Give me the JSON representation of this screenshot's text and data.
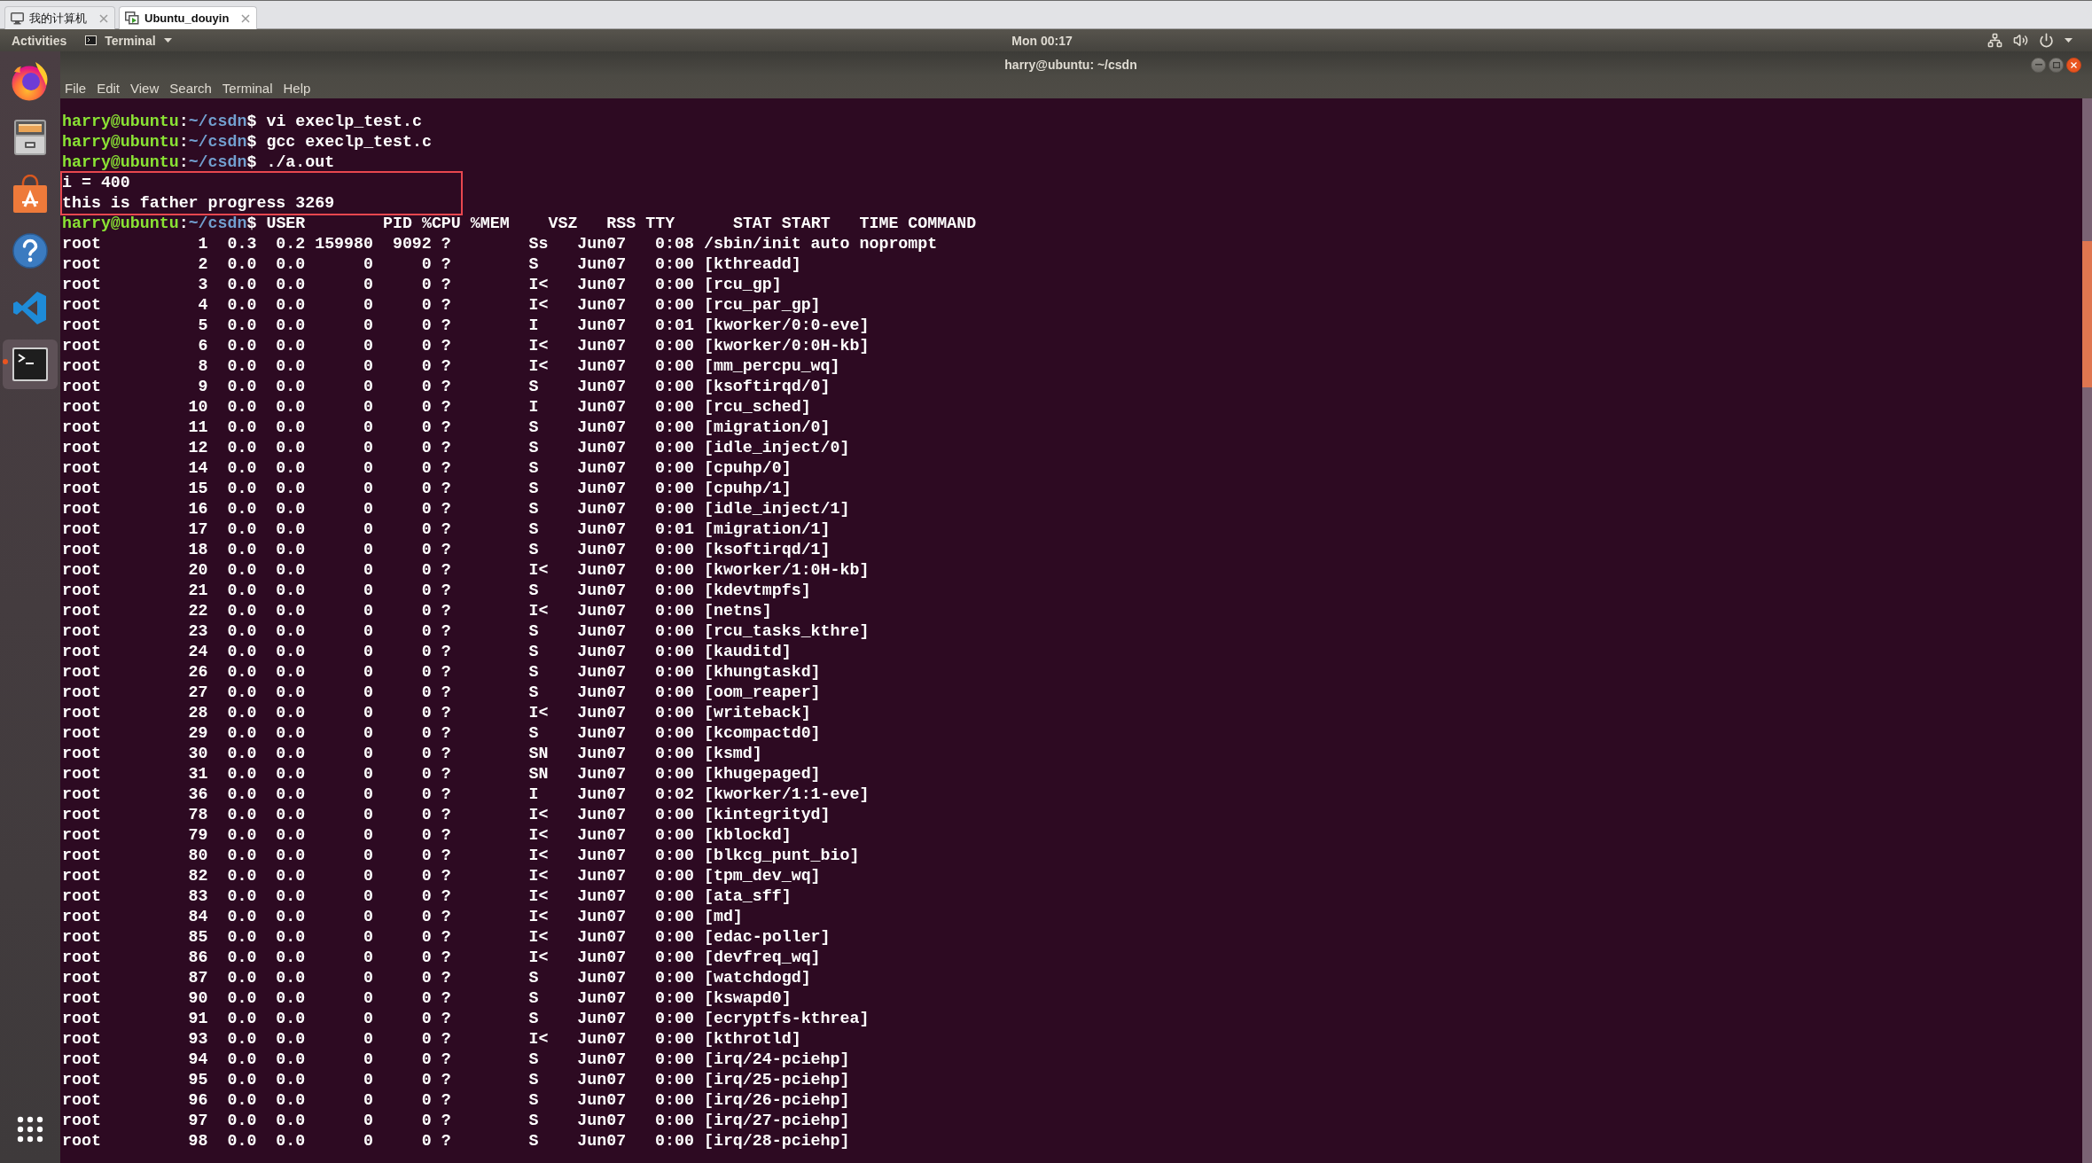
{
  "host_tabs": [
    {
      "kind": "computer",
      "label": "我的计算机",
      "selected": false
    },
    {
      "kind": "machine",
      "label": "Ubuntu_douyin",
      "selected": true
    }
  ],
  "top_bar": {
    "activities": "Activities",
    "app_menu": "Terminal",
    "clock": "Mon 00:17"
  },
  "dock": {
    "items": [
      {
        "kind": "browser",
        "running": false,
        "selected": false
      },
      {
        "kind": "files",
        "running": false,
        "selected": false
      },
      {
        "kind": "store",
        "running": false,
        "selected": false
      },
      {
        "kind": "help",
        "running": false,
        "selected": false
      },
      {
        "kind": "editor",
        "running": false,
        "selected": false
      },
      {
        "kind": "terminal",
        "running": true,
        "selected": true
      }
    ]
  },
  "window": {
    "title": "harry@ubuntu: ~/csdn",
    "menu": [
      "File",
      "Edit",
      "View",
      "Search",
      "Terminal",
      "Help"
    ]
  },
  "terminal": {
    "commands": [
      {
        "prompt": {
          "user": "harry@ubuntu",
          "separator": ":",
          "path": "~/csdn",
          "symbol": "$"
        },
        "command": "vi execlp_test.c"
      },
      {
        "prompt": {
          "user": "harry@ubuntu",
          "separator": ":",
          "path": "~/csdn",
          "symbol": "$"
        },
        "command": "gcc execlp_test.c"
      },
      {
        "prompt": {
          "user": "harry@ubuntu",
          "separator": ":",
          "path": "~/csdn",
          "symbol": "$"
        },
        "command": "./a.out"
      }
    ],
    "highlighted_output": [
      "i = 400",
      "this is father progress 3269"
    ],
    "ps_header_line": {
      "prompt": {
        "user": "harry@ubuntu",
        "separator": ":",
        "path": "~/csdn",
        "symbol": "$"
      },
      "fields": [
        "USER",
        "PID",
        "%CPU",
        "%MEM",
        "VSZ",
        "RSS",
        "TTY",
        "STAT",
        "START",
        "TIME",
        "COMMAND"
      ]
    },
    "ps_output": {
      "rows": [
        [
          "root",
          "1",
          "0.3",
          "0.2",
          "159980",
          "9092",
          "?",
          "Ss",
          "Jun07",
          "0:08",
          "/sbin/init auto noprompt"
        ],
        [
          "root",
          "2",
          "0.0",
          "0.0",
          "0",
          "0",
          "?",
          "S",
          "Jun07",
          "0:00",
          "[kthreadd]"
        ],
        [
          "root",
          "3",
          "0.0",
          "0.0",
          "0",
          "0",
          "?",
          "I<",
          "Jun07",
          "0:00",
          "[rcu_gp]"
        ],
        [
          "root",
          "4",
          "0.0",
          "0.0",
          "0",
          "0",
          "?",
          "I<",
          "Jun07",
          "0:00",
          "[rcu_par_gp]"
        ],
        [
          "root",
          "5",
          "0.0",
          "0.0",
          "0",
          "0",
          "?",
          "I",
          "Jun07",
          "0:01",
          "[kworker/0:0-eve]"
        ],
        [
          "root",
          "6",
          "0.0",
          "0.0",
          "0",
          "0",
          "?",
          "I<",
          "Jun07",
          "0:00",
          "[kworker/0:0H-kb]"
        ],
        [
          "root",
          "8",
          "0.0",
          "0.0",
          "0",
          "0",
          "?",
          "I<",
          "Jun07",
          "0:00",
          "[mm_percpu_wq]"
        ],
        [
          "root",
          "9",
          "0.0",
          "0.0",
          "0",
          "0",
          "?",
          "S",
          "Jun07",
          "0:00",
          "[ksoftirqd/0]"
        ],
        [
          "root",
          "10",
          "0.0",
          "0.0",
          "0",
          "0",
          "?",
          "I",
          "Jun07",
          "0:00",
          "[rcu_sched]"
        ],
        [
          "root",
          "11",
          "0.0",
          "0.0",
          "0",
          "0",
          "?",
          "S",
          "Jun07",
          "0:00",
          "[migration/0]"
        ],
        [
          "root",
          "12",
          "0.0",
          "0.0",
          "0",
          "0",
          "?",
          "S",
          "Jun07",
          "0:00",
          "[idle_inject/0]"
        ],
        [
          "root",
          "14",
          "0.0",
          "0.0",
          "0",
          "0",
          "?",
          "S",
          "Jun07",
          "0:00",
          "[cpuhp/0]"
        ],
        [
          "root",
          "15",
          "0.0",
          "0.0",
          "0",
          "0",
          "?",
          "S",
          "Jun07",
          "0:00",
          "[cpuhp/1]"
        ],
        [
          "root",
          "16",
          "0.0",
          "0.0",
          "0",
          "0",
          "?",
          "S",
          "Jun07",
          "0:00",
          "[idle_inject/1]"
        ],
        [
          "root",
          "17",
          "0.0",
          "0.0",
          "0",
          "0",
          "?",
          "S",
          "Jun07",
          "0:01",
          "[migration/1]"
        ],
        [
          "root",
          "18",
          "0.0",
          "0.0",
          "0",
          "0",
          "?",
          "S",
          "Jun07",
          "0:00",
          "[ksoftirqd/1]"
        ],
        [
          "root",
          "20",
          "0.0",
          "0.0",
          "0",
          "0",
          "?",
          "I<",
          "Jun07",
          "0:00",
          "[kworker/1:0H-kb]"
        ],
        [
          "root",
          "21",
          "0.0",
          "0.0",
          "0",
          "0",
          "?",
          "S",
          "Jun07",
          "0:00",
          "[kdevtmpfs]"
        ],
        [
          "root",
          "22",
          "0.0",
          "0.0",
          "0",
          "0",
          "?",
          "I<",
          "Jun07",
          "0:00",
          "[netns]"
        ],
        [
          "root",
          "23",
          "0.0",
          "0.0",
          "0",
          "0",
          "?",
          "S",
          "Jun07",
          "0:00",
          "[rcu_tasks_kthre]"
        ],
        [
          "root",
          "24",
          "0.0",
          "0.0",
          "0",
          "0",
          "?",
          "S",
          "Jun07",
          "0:00",
          "[kauditd]"
        ],
        [
          "root",
          "26",
          "0.0",
          "0.0",
          "0",
          "0",
          "?",
          "S",
          "Jun07",
          "0:00",
          "[khungtaskd]"
        ],
        [
          "root",
          "27",
          "0.0",
          "0.0",
          "0",
          "0",
          "?",
          "S",
          "Jun07",
          "0:00",
          "[oom_reaper]"
        ],
        [
          "root",
          "28",
          "0.0",
          "0.0",
          "0",
          "0",
          "?",
          "I<",
          "Jun07",
          "0:00",
          "[writeback]"
        ],
        [
          "root",
          "29",
          "0.0",
          "0.0",
          "0",
          "0",
          "?",
          "S",
          "Jun07",
          "0:00",
          "[kcompactd0]"
        ],
        [
          "root",
          "30",
          "0.0",
          "0.0",
          "0",
          "0",
          "?",
          "SN",
          "Jun07",
          "0:00",
          "[ksmd]"
        ],
        [
          "root",
          "31",
          "0.0",
          "0.0",
          "0",
          "0",
          "?",
          "SN",
          "Jun07",
          "0:00",
          "[khugepaged]"
        ],
        [
          "root",
          "36",
          "0.0",
          "0.0",
          "0",
          "0",
          "?",
          "I",
          "Jun07",
          "0:02",
          "[kworker/1:1-eve]"
        ],
        [
          "root",
          "78",
          "0.0",
          "0.0",
          "0",
          "0",
          "?",
          "I<",
          "Jun07",
          "0:00",
          "[kintegrityd]"
        ],
        [
          "root",
          "79",
          "0.0",
          "0.0",
          "0",
          "0",
          "?",
          "I<",
          "Jun07",
          "0:00",
          "[kblockd]"
        ],
        [
          "root",
          "80",
          "0.0",
          "0.0",
          "0",
          "0",
          "?",
          "I<",
          "Jun07",
          "0:00",
          "[blkcg_punt_bio]"
        ],
        [
          "root",
          "82",
          "0.0",
          "0.0",
          "0",
          "0",
          "?",
          "I<",
          "Jun07",
          "0:00",
          "[tpm_dev_wq]"
        ],
        [
          "root",
          "83",
          "0.0",
          "0.0",
          "0",
          "0",
          "?",
          "I<",
          "Jun07",
          "0:00",
          "[ata_sff]"
        ],
        [
          "root",
          "84",
          "0.0",
          "0.0",
          "0",
          "0",
          "?",
          "I<",
          "Jun07",
          "0:00",
          "[md]"
        ],
        [
          "root",
          "85",
          "0.0",
          "0.0",
          "0",
          "0",
          "?",
          "I<",
          "Jun07",
          "0:00",
          "[edac-poller]"
        ],
        [
          "root",
          "86",
          "0.0",
          "0.0",
          "0",
          "0",
          "?",
          "I<",
          "Jun07",
          "0:00",
          "[devfreq_wq]"
        ],
        [
          "root",
          "87",
          "0.0",
          "0.0",
          "0",
          "0",
          "?",
          "S",
          "Jun07",
          "0:00",
          "[watchdogd]"
        ],
        [
          "root",
          "90",
          "0.0",
          "0.0",
          "0",
          "0",
          "?",
          "S",
          "Jun07",
          "0:00",
          "[kswapd0]"
        ],
        [
          "root",
          "91",
          "0.0",
          "0.0",
          "0",
          "0",
          "?",
          "S",
          "Jun07",
          "0:00",
          "[ecryptfs-kthrea]"
        ],
        [
          "root",
          "93",
          "0.0",
          "0.0",
          "0",
          "0",
          "?",
          "I<",
          "Jun07",
          "0:00",
          "[kthrotld]"
        ],
        [
          "root",
          "94",
          "0.0",
          "0.0",
          "0",
          "0",
          "?",
          "S",
          "Jun07",
          "0:00",
          "[irq/24-pciehp]"
        ],
        [
          "root",
          "95",
          "0.0",
          "0.0",
          "0",
          "0",
          "?",
          "S",
          "Jun07",
          "0:00",
          "[irq/25-pciehp]"
        ],
        [
          "root",
          "96",
          "0.0",
          "0.0",
          "0",
          "0",
          "?",
          "S",
          "Jun07",
          "0:00",
          "[irq/26-pciehp]"
        ],
        [
          "root",
          "97",
          "0.0",
          "0.0",
          "0",
          "0",
          "?",
          "S",
          "Jun07",
          "0:00",
          "[irq/27-pciehp]"
        ],
        [
          "root",
          "98",
          "0.0",
          "0.0",
          "0",
          "0",
          "?",
          "S",
          "Jun07",
          "0:00",
          "[irq/28-pciehp]"
        ]
      ]
    }
  }
}
